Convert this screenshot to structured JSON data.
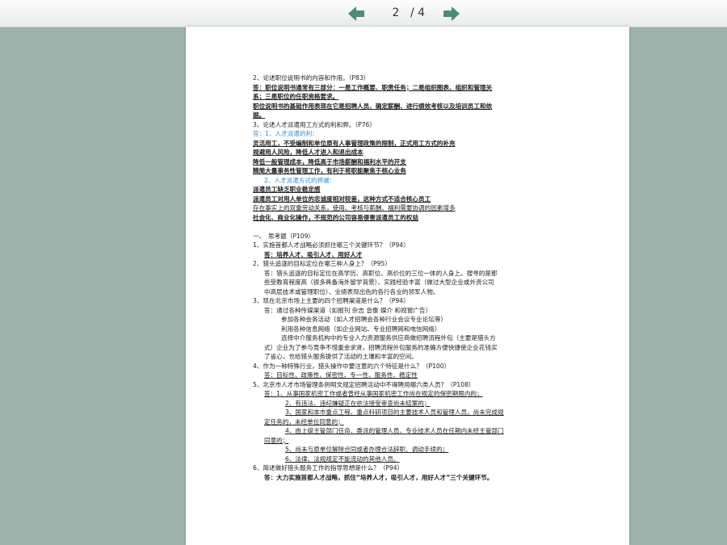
{
  "toolbar": {
    "prev_icon": "arrow-left-icon",
    "next_icon": "arrow-right-icon",
    "current_page": "2",
    "total_pages": "/ 4",
    "accent_color": "#4f8a7a"
  },
  "document": {
    "lines": [
      "2、论述职位说明书的内容和作用。（P83）",
      "答：职位说明书通常有三部分：一是工作概要、职责任务；二是组织图表、组织和管理关",
      "系；三是职位的任职资格要求。",
      "职位说明书的基础作用表现在它是招聘人员、确定薪酬、进行绩效考核以及培训员工和依",
      "据。",
      "3、论述人才派遣用工方式的利和弊。（P76）",
      "答：1、人才派遣的利：",
      "灵活用工，不受编制和单位原有人事管理政策的限制，正式用工方式的补充",
      "规避用人风险，降低人才进入和退出成本",
      "降低一般管理成本，降低高于市场薪酬和福利水平的开支",
      "精简大量事务性管理工作，有利于将职能聚焦于核心业务",
      "2、人才派遣方式的弊端：",
      "派遣员工缺乏职业稳定感",
      "派遣员工对用人单位的忠诚度相对较差，这种方式不适合核心员工",
      "存在事实上的双重劳动关系，使用、考核与薪酬、福利需要协调的因素增多",
      "社会化、商业化操作，不规范的公司容易侵害派遣员工的权益",
      "",
      "一、　思考题（P109）",
      "1、实施首都人才战略必须抓住哪三个关键环节？（P94）",
      "答：培养人才、吸引人才、用好人才",
      "2、猎头追逐的目标定位在哪三种人身上？（P95）",
      "答：猎头追逐的目标定位在高学历、高职位、高价位的三位一体的人身上。搜寻的是那",
      "些受教育程度高（很多具备海外留学背景）、实践经验丰富（做过大型企业或外资公司",
      "中高层技术或管理职位）、业绩表现出色的各行各业的领军人物。",
      "3、现在北京市场上主要的四个招聘渠道是什么？（P94）",
      "答：通过各种传媒渠道（如报刊 杂志 音像 媒介 和视窗广告）",
      "参加各种会务活动（如人才招聘会各种行业会议专业论坛等）",
      "利用各种信息网络（如企业网站、专业招聘网和电信网络）",
      "选择中介服务机构中的专业人力资源服务供应商做招聘流程外包（主要是猎头方",
      "式）企业为了参与竞争不惜重金求贤，招聘流程外包服务的准确方便快捷使企业花钱买",
      "了省心，也给猎头服务提供了活动的土壤和丰富的空间。",
      "4、作为一种特殊行业，猎头操作中要注意的六个特征是什么？（P100）",
      "答：目标性、政策性、保密性、专一性、服务性、稳定性",
      "5、北京市人才市场管理条例明文规定招聘活动中不得聘用哪六类人员？（P108）",
      "答：1、从事国家机密工作或者曾经从事国家机密工作尚在规定的保密期限内的；",
      "2、有违法、违纪嫌疑正在依法接受审查尚未结案的；",
      "3、国家和本市重点工程、重点科研项目的主要技术人员和管理人员，尚未完成规",
      "定任务的，未经单位同意的；",
      "4、由上级主管部门任命、委派的管理人员、专业技术人员在任期内未经主管部门",
      "同意的；",
      "5、尚未与原单位解除合同或者办理合法辞职、调动手续的；",
      "6、法律、法规规定不能流动的其他人员。",
      "6、简述做好猎头服务工作的指导思想是什么？（P94）",
      "答：大力实施首都人才战略，抓住“培养人才，吸引人才，用好人才”三个关键环节。"
    ]
  }
}
